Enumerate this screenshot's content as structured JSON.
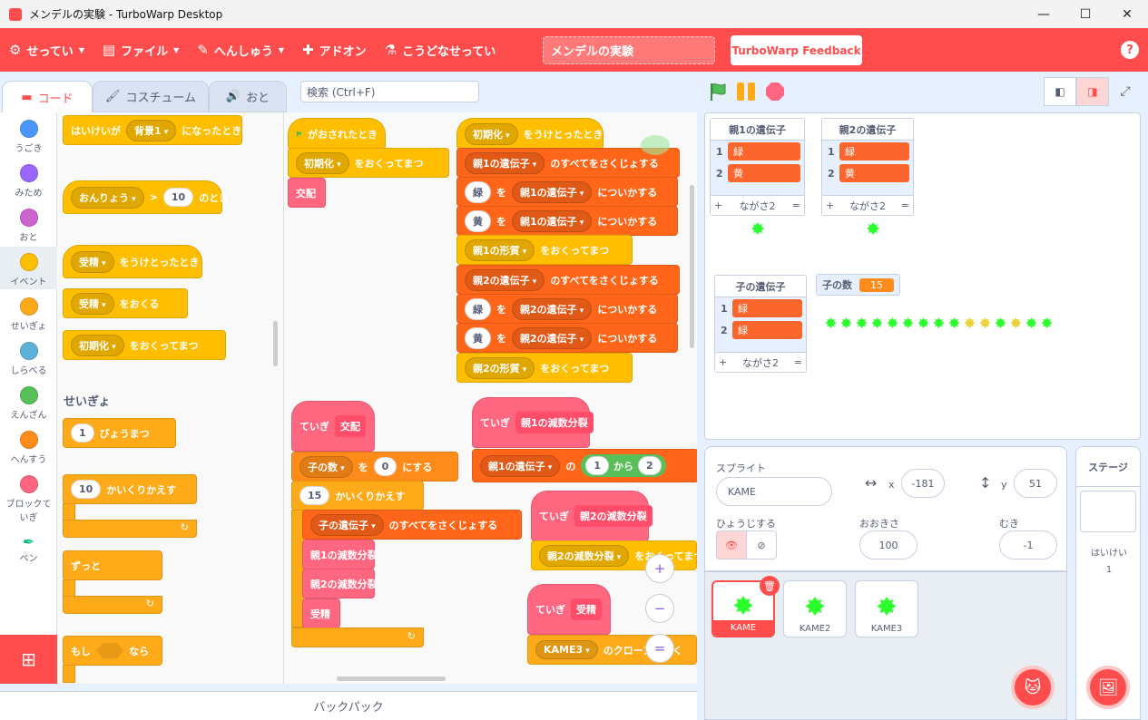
{
  "window": {
    "title": "メンデルの実験 - TurboWarp Desktop",
    "minimize": "—",
    "maximize": "☐",
    "close": "✕"
  },
  "menu": {
    "settings": "せってい",
    "file": "ファイル",
    "edit": "へんしゅう",
    "addons": "アドオン",
    "tutorial": "こうどなせってい",
    "project_title": "メンデルの実験",
    "feedback": "TurboWarp Feedback",
    "help": "?"
  },
  "tabs": {
    "code": "コード",
    "costumes": "コスチューム",
    "sounds": "おと"
  },
  "search": {
    "placeholder": "検索 (Ctrl+F)"
  },
  "categories": [
    {
      "label": "うごき",
      "color": "#4c97ff"
    },
    {
      "label": "みため",
      "color": "#9966ff"
    },
    {
      "label": "おと",
      "color": "#cf63cf"
    },
    {
      "label": "イベント",
      "color": "#ffbf00"
    },
    {
      "label": "せいぎょ",
      "color": "#ffab19"
    },
    {
      "label": "しらべる",
      "color": "#5cb1d6"
    },
    {
      "label": "えんざん",
      "color": "#59c059"
    },
    {
      "label": "へんすう",
      "color": "#ff8c1a"
    },
    {
      "label": "ブロックていぎ",
      "color": "#ff6680"
    },
    {
      "label": "ペン",
      "color": "#0fbd8c"
    }
  ],
  "palette": {
    "backdrop_when": "はいけいが",
    "backdrop_value": "背景1",
    "backdrop_suffix": "になったとき",
    "loudness": "おんりょう",
    "gt": ">",
    "loud_value": "10",
    "loud_suffix": "のとき",
    "receive_value": "受精",
    "receive_suffix": "をうけとったとき",
    "broadcast_value": "受精",
    "broadcast_suffix": "をおくる",
    "broadcast_wait_value": "初期化",
    "broadcast_wait_suffix": "をおくってまつ",
    "section_control": "せいぎょ",
    "wait_value": "1",
    "wait_suffix": "びょうまつ",
    "repeat_value": "10",
    "repeat_suffix": "かいくりかえす",
    "forever": "ずっと",
    "if_prefix": "もし",
    "if_suffix": "なら"
  },
  "workspace": {
    "flag_clicked": "がおされたとき",
    "init": "初期化",
    "send_wait": "をおくってまつ",
    "kouhai": "交配",
    "receive_init": "初期化",
    "receive_suffix": "をうけとったとき",
    "parent1_genes": "親1の遺伝子",
    "parent2_genes": "親2の遺伝子",
    "delete_all": "のすべてをさくじょする",
    "green": "緑",
    "yellow": "黄",
    "wo": "を",
    "add_to": "についかする",
    "parent1_trait": "親1の形質",
    "parent2_trait": "親2の形質",
    "define": "ていぎ",
    "def_kouhai": "交配",
    "child_count": "子の数",
    "zero": "0",
    "set_to": "にする",
    "repeat15": "15",
    "repeat_suffix": "かいくりかえす",
    "child_genes": "子の遺伝子",
    "parent1_meiosis": "親1の減数分裂",
    "parent2_meiosis": "親2の減数分裂",
    "fertilize": "受精",
    "no": "の",
    "from1": "1",
    "kara": "から",
    "to2": "2",
    "kame3": "KAME3",
    "clone_suffix": "のクローンをつく",
    "zoom_in": "+",
    "zoom_out": "−",
    "zoom_reset": "="
  },
  "stage": {
    "list1": {
      "title": "親1の遺伝子",
      "items": [
        "緑",
        "黄"
      ],
      "length": "ながさ2"
    },
    "list2": {
      "title": "親2の遺伝子",
      "items": [
        "緑",
        "黄"
      ],
      "length": "ながさ2"
    },
    "list3": {
      "title": "子の遺伝子",
      "items": [
        "緑",
        "緑"
      ],
      "length": "ながさ2"
    },
    "plus": "+",
    "eq": "=",
    "var_child_count": {
      "name": "子の数",
      "value": "15"
    },
    "child_turtles": [
      "g",
      "g",
      "g",
      "g",
      "g",
      "g",
      "g",
      "g",
      "g",
      "y",
      "y",
      "g",
      "y",
      "g",
      "g"
    ]
  },
  "sprite": {
    "label": "スプライト",
    "name": "KAME",
    "x_label": "x",
    "x": "-181",
    "y_label": "y",
    "y": "51",
    "show_label": "ひょうじする",
    "size_label": "おおきさ",
    "size": "100",
    "direction_label": "むき",
    "direction": "-1"
  },
  "sprites": [
    "KAME",
    "KAME2",
    "KAME3"
  ],
  "stage_panel": {
    "title": "ステージ",
    "backdrops_label": "はいけい",
    "backdrops_count": "1"
  },
  "backpack": "バックパック"
}
